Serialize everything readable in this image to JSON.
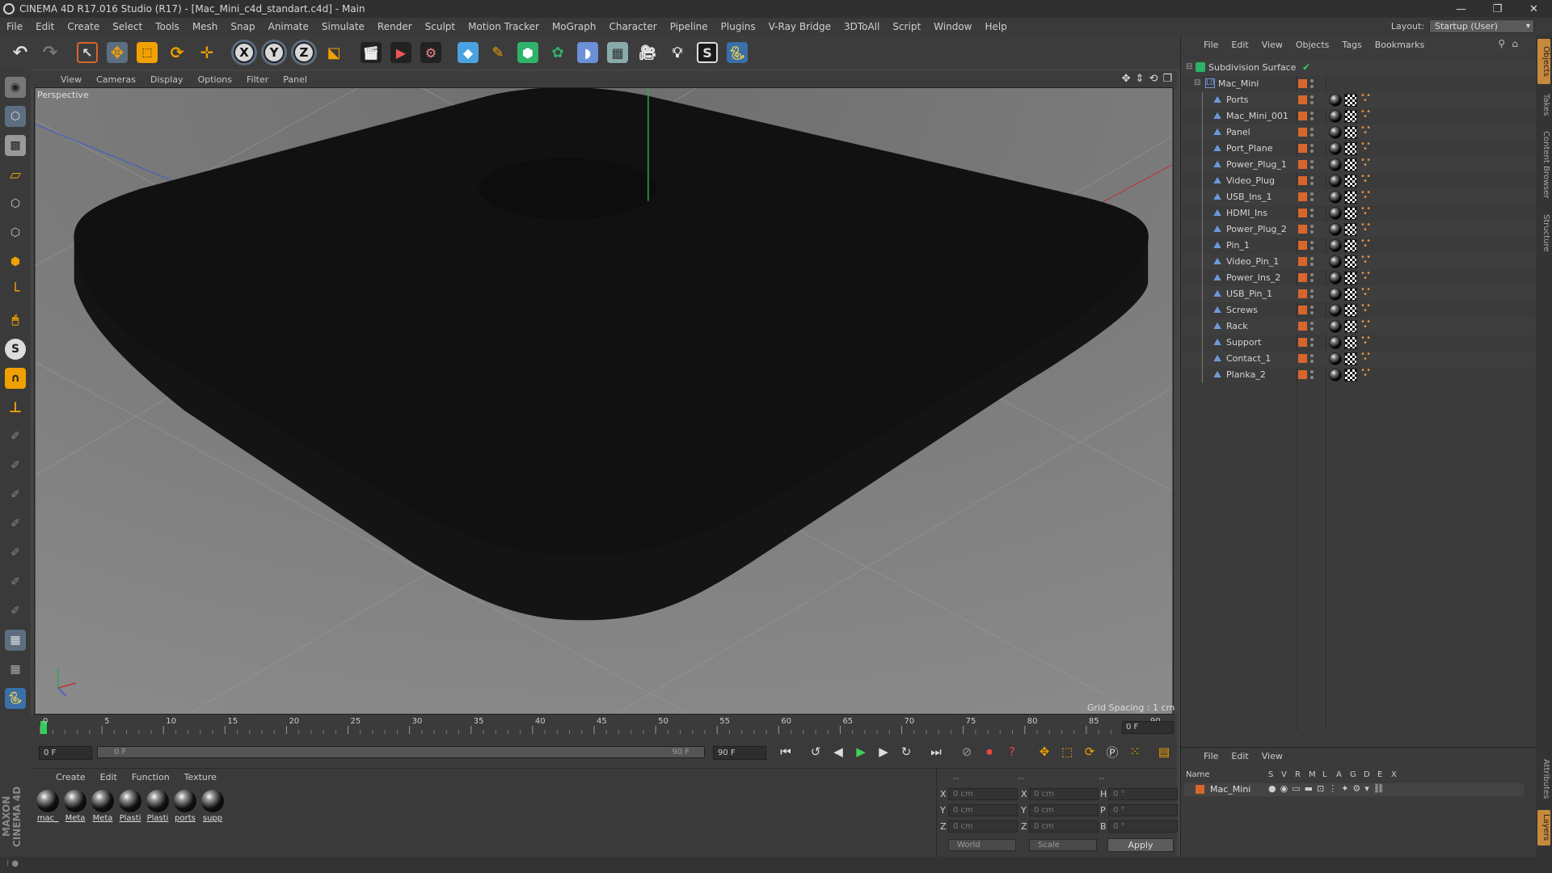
{
  "window": {
    "title": "CINEMA 4D R17.016 Studio (R17) - [Mac_Mini_c4d_standart.c4d] - Main",
    "controls": [
      "—",
      "❐",
      "✕"
    ]
  },
  "menubar": {
    "items": [
      "File",
      "Edit",
      "Create",
      "Select",
      "Tools",
      "Mesh",
      "Snap",
      "Animate",
      "Simulate",
      "Render",
      "Sculpt",
      "Motion Tracker",
      "MoGraph",
      "Character",
      "Pipeline",
      "Plugins",
      "V-Ray Bridge",
      "3DToAll",
      "Script",
      "Window",
      "Help"
    ],
    "layout_label": "Layout:",
    "layout_value": "Startup (User)"
  },
  "toolbar": {
    "axis_labels": [
      "X",
      "Y",
      "Z"
    ]
  },
  "viewport": {
    "menu": [
      "View",
      "Cameras",
      "Display",
      "Options",
      "Filter",
      "Panel"
    ],
    "camera_label": "Perspective",
    "grid_spacing": "Grid Spacing : 1 cm"
  },
  "timeline": {
    "ticks": [
      "0",
      "5",
      "10",
      "15",
      "20",
      "25",
      "30",
      "35",
      "40",
      "45",
      "50",
      "55",
      "60",
      "65",
      "70",
      "75",
      "80",
      "85",
      "90"
    ],
    "current_frame": "0 F",
    "start_field": "0 F",
    "range_start": "0 F",
    "range_end": "90 F",
    "end_field": "90 F"
  },
  "material_manager": {
    "menu": [
      "Create",
      "Edit",
      "Function",
      "Texture"
    ],
    "materials": [
      "mac_",
      "Meta",
      "Meta",
      "Plasti",
      "Plasti",
      "ports",
      "supp"
    ]
  },
  "coordinates": {
    "header": [
      "--",
      "--",
      "--"
    ],
    "rows": [
      {
        "l1": "X",
        "v1": "0 cm",
        "l2": "X",
        "v2": "0 cm",
        "l3": "H",
        "v3": "0 °"
      },
      {
        "l1": "Y",
        "v1": "0 cm",
        "l2": "Y",
        "v2": "0 cm",
        "l3": "P",
        "v3": "0 °"
      },
      {
        "l1": "Z",
        "v1": "0 cm",
        "l2": "Z",
        "v2": "0 cm",
        "l3": "B",
        "v3": "0 °"
      }
    ],
    "world": "World",
    "scale": "Scale",
    "apply": "Apply"
  },
  "object_manager": {
    "menu": [
      "File",
      "Edit",
      "View",
      "Objects",
      "Tags",
      "Bookmarks"
    ],
    "root": "Subdivision Surface",
    "group": "Mac_Mini",
    "objects": [
      "Ports",
      "Mac_Mini_001",
      "Panel",
      "Port_Plane",
      "Power_Plug_1",
      "Video_Plug",
      "USB_Ins_1",
      "HDMI_Ins",
      "Power_Plug_2",
      "Pin_1",
      "Video_Pin_1",
      "Power_Ins_2",
      "USB_Pin_1",
      "Screws",
      "Rack",
      "Support",
      "Contact_1",
      "Planka_2"
    ]
  },
  "layer_manager": {
    "menu": [
      "File",
      "Edit",
      "View"
    ],
    "columns": [
      "Name",
      "S",
      "V",
      "R",
      "M",
      "L",
      "A",
      "G",
      "D",
      "E",
      "X"
    ],
    "layer_name": "Mac_Mini"
  },
  "right_tabs": [
    "Objects",
    "Takes",
    "Content Browser",
    "Structure",
    "Attributes",
    "Layers"
  ],
  "branding": "MAXON CINEMA 4D",
  "colors": {
    "accent_orange": "#d8662c",
    "x_axis": "#c03030",
    "y_axis": "#2fa84f",
    "z_axis": "#3a5ec8"
  }
}
